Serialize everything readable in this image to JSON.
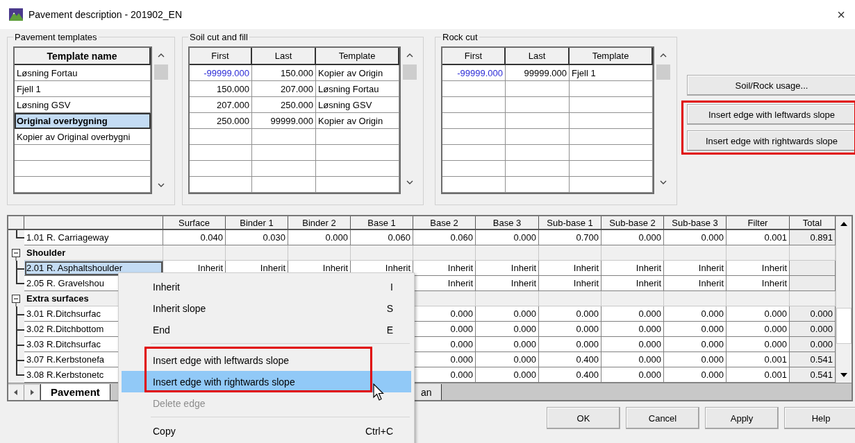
{
  "window": {
    "title": "Pavement description - 201902_EN",
    "close": "×"
  },
  "templates": {
    "legend": "Pavement templates",
    "header": "Template name",
    "items": [
      {
        "name": "Løsning Fortau",
        "selected": false
      },
      {
        "name": "Fjell 1",
        "selected": false
      },
      {
        "name": "Løsning GSV",
        "selected": false
      },
      {
        "name": "Original overbygning",
        "selected": true
      },
      {
        "name": "Kopier av Original overbygni",
        "selected": false
      }
    ]
  },
  "soil": {
    "legend": "Soil cut and fill",
    "columns": [
      "First",
      "Last",
      "Template"
    ],
    "rows": [
      {
        "first": "-99999.000",
        "last": "150.000",
        "template": "Kopier av Origin",
        "color": "#2b2bd6"
      },
      {
        "first": "150.000",
        "last": "207.000",
        "template": "Løsning Fortau",
        "color": "#000000"
      },
      {
        "first": "207.000",
        "last": "250.000",
        "template": "Løsning GSV",
        "color": "#000000"
      },
      {
        "first": "250.000",
        "last": "99999.000",
        "template": "Kopier av Origin",
        "color": "#000000"
      }
    ]
  },
  "rock": {
    "legend": "Rock cut",
    "columns": [
      "First",
      "Last",
      "Template"
    ],
    "rows": [
      {
        "first": "-99999.000",
        "last": "99999.000",
        "template": "Fjell 1",
        "color": "#2b2bd6"
      }
    ]
  },
  "side_buttons": [
    {
      "label": "Soil/Rock usage...",
      "framed": false
    },
    {
      "label": "Insert edge with leftwards slope",
      "framed": true
    },
    {
      "label": "Insert edge with rightwards slope",
      "framed": true
    }
  ],
  "grid": {
    "columns": [
      "Surface",
      "Binder 1",
      "Binder 2",
      "Base 1",
      "Base 2",
      "Base 3",
      "Sub-base 1",
      "Sub-base 2",
      "Sub-base 3",
      "Filter",
      "Total"
    ],
    "rows": [
      {
        "kind": "item",
        "name": "1.01 R. Carriageway",
        "selected": false,
        "cells": [
          "0.040",
          "0.030",
          "0.000",
          "0.060",
          "0.060",
          "0.000",
          "0.700",
          "0.000",
          "0.000",
          "0.001",
          "0.891"
        ]
      },
      {
        "kind": "group",
        "name": "Shoulder",
        "expanded": true,
        "children": [
          {
            "kind": "item",
            "name": "2.01 R. Asphaltshoulder",
            "selected": true,
            "cells": [
              "Inherit",
              "Inherit",
              "Inherit",
              "Inherit",
              "Inherit",
              "Inherit",
              "Inherit",
              "Inherit",
              "Inherit",
              "Inherit",
              null
            ]
          },
          {
            "kind": "item",
            "name": "2.05 R. Gravelshou",
            "selected": false,
            "cells": [
              null,
              null,
              null,
              null,
              "Inherit",
              "Inherit",
              "Inherit",
              "Inherit",
              "Inherit",
              "Inherit",
              null
            ]
          }
        ]
      },
      {
        "kind": "group",
        "name": "Extra surfaces",
        "expanded": true,
        "children": [
          {
            "kind": "item",
            "name": "3.01 R.Ditchsurfac",
            "selected": false,
            "cells": [
              null,
              null,
              null,
              null,
              "0.000",
              "0.000",
              "0.000",
              "0.000",
              "0.000",
              "0.000",
              "0.000"
            ]
          },
          {
            "kind": "item",
            "name": "3.02 R.Ditchbottom",
            "selected": false,
            "cells": [
              null,
              null,
              null,
              null,
              "0.000",
              "0.000",
              "0.000",
              "0.000",
              "0.000",
              "0.000",
              "0.000"
            ]
          },
          {
            "kind": "item",
            "name": "3.03 R.Ditchsurfac",
            "selected": false,
            "cells": [
              null,
              null,
              null,
              null,
              "0.000",
              "0.000",
              "0.000",
              "0.000",
              "0.000",
              "0.000",
              "0.000"
            ]
          },
          {
            "kind": "item",
            "name": "3.07 R.Kerbstonefa",
            "selected": false,
            "cells": [
              null,
              null,
              null,
              null,
              "0.000",
              "0.000",
              "0.400",
              "0.000",
              "0.000",
              "0.001",
              "0.541"
            ]
          },
          {
            "kind": "item",
            "name": "3.08 R.Kerbstonetc",
            "selected": false,
            "cells": [
              null,
              null,
              null,
              null,
              "0.000",
              "0.000",
              "0.400",
              "0.000",
              "0.000",
              "0.001",
              "0.541"
            ]
          }
        ]
      }
    ],
    "tabs": [
      {
        "label": "Pavement",
        "selected": true
      },
      {
        "label": "an",
        "selected": false
      }
    ]
  },
  "dialog_buttons": [
    "OK",
    "Cancel",
    "Apply",
    "Help"
  ],
  "context_menu": {
    "items": [
      {
        "kind": "item",
        "label": "Inherit",
        "shortcut": "I",
        "disabled": false,
        "selected": false,
        "framed": false
      },
      {
        "kind": "item",
        "label": "Inherit slope",
        "shortcut": "S",
        "disabled": false,
        "selected": false,
        "framed": false
      },
      {
        "kind": "item",
        "label": "End",
        "shortcut": "E",
        "disabled": false,
        "selected": false,
        "framed": false
      },
      {
        "kind": "separator"
      },
      {
        "kind": "item",
        "label": "Insert edge with leftwards slope",
        "disabled": false,
        "selected": false,
        "framed": true
      },
      {
        "kind": "item",
        "label": "Insert edge with rightwards slope",
        "disabled": false,
        "selected": true,
        "framed": true
      },
      {
        "kind": "item",
        "label": "Delete edge",
        "disabled": true,
        "selected": false,
        "framed": false
      },
      {
        "kind": "separator"
      },
      {
        "kind": "item",
        "label": "Copy",
        "shortcut": "Ctrl+C",
        "disabled": false,
        "selected": false,
        "framed": false
      }
    ]
  }
}
